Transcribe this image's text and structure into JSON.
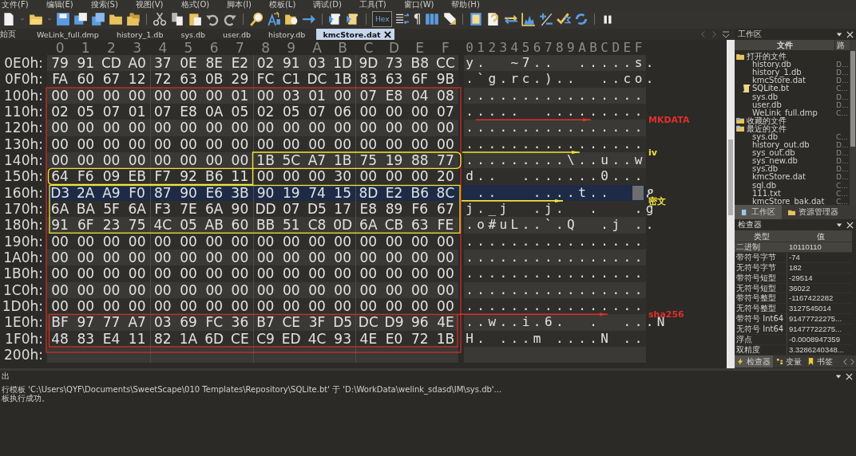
{
  "menu": [
    "文件(F)",
    "编辑(E)",
    "搜索(S)",
    "视图(V)",
    "格式(O)",
    "脚本(I)",
    "模板(L)",
    "调试(D)",
    "工具(T)",
    "窗口(W)",
    "帮助(H)"
  ],
  "toolbar": {
    "hex_toggle": {
      "label": "Hex",
      "on": true
    },
    "pilcrow": "¶"
  },
  "tabs": [
    {
      "label": "始页",
      "selected": false
    },
    {
      "label": "WeLink_full.dmp",
      "selected": false
    },
    {
      "label": "history_1.db",
      "selected": false
    },
    {
      "label": "sys.db",
      "selected": false
    },
    {
      "label": "user.db",
      "selected": false
    },
    {
      "label": "history.db",
      "selected": false
    },
    {
      "label": "kmcStore.dat",
      "selected": true
    }
  ],
  "hex_view": {
    "column_headers": [
      "0",
      "1",
      "2",
      "3",
      "4",
      "5",
      "6",
      "7",
      "8",
      "9",
      "A",
      "B",
      "C",
      "D",
      "E",
      "F"
    ],
    "text_header": "0123456789ABCDEF",
    "rows": [
      {
        "offset": "0E0h:",
        "bytes": [
          "79",
          "91",
          "CD",
          "A0",
          "37",
          "0E",
          "8E",
          "E2",
          "02",
          "91",
          "03",
          "1D",
          "9D",
          "73",
          "B8",
          "CC"
        ],
        "text": "y.  ~7..  .....s.",
        "selected": false
      },
      {
        "offset": "0F0h:",
        "bytes": [
          "FA",
          "60",
          "67",
          "12",
          "72",
          "63",
          "0B",
          "29",
          "FC",
          "C1",
          "DC",
          "1B",
          "83",
          "63",
          "6F",
          "9B"
        ],
        "text": ".`g.rc.)..  ..co.",
        "selected": false
      },
      {
        "offset": "100h:",
        "bytes": [
          "00",
          "00",
          "00",
          "00",
          "00",
          "00",
          "00",
          "01",
          "00",
          "03",
          "01",
          "00",
          "07",
          "E8",
          "04",
          "08"
        ],
        "text": "................",
        "selected": false
      },
      {
        "offset": "110h:",
        "bytes": [
          "02",
          "05",
          "07",
          "01",
          "07",
          "E8",
          "0A",
          "05",
          "02",
          "05",
          "07",
          "06",
          "00",
          "00",
          "00",
          "07"
        ],
        "text": ".....  .........",
        "selected": false
      },
      {
        "offset": "120h:",
        "bytes": [
          "00",
          "00",
          "00",
          "00",
          "00",
          "00",
          "00",
          "00",
          "00",
          "00",
          "00",
          "00",
          "00",
          "00",
          "00",
          "00"
        ],
        "text": "................",
        "selected": false
      },
      {
        "offset": "130h:",
        "bytes": [
          "00",
          "00",
          "00",
          "00",
          "00",
          "00",
          "00",
          "00",
          "00",
          "00",
          "00",
          "00",
          "00",
          "00",
          "00",
          "00"
        ],
        "text": "................",
        "selected": false
      },
      {
        "offset": "140h:",
        "bytes": [
          "00",
          "00",
          "00",
          "00",
          "00",
          "00",
          "00",
          "00",
          "1B",
          "5C",
          "A7",
          "1B",
          "75",
          "19",
          "88",
          "77"
        ],
        "text": ".........\\..u..w",
        "selected": false
      },
      {
        "offset": "150h:",
        "bytes": [
          "64",
          "F6",
          "09",
          "EB",
          "F7",
          "92",
          "B6",
          "11",
          "00",
          "00",
          "00",
          "30",
          "00",
          "00",
          "00",
          "20"
        ],
        "text": "d..  .......0...",
        "selected": false
      },
      {
        "offset": "160h:",
        "bytes": [
          "D3",
          "2A",
          "A9",
          "F0",
          "87",
          "90",
          "E6",
          "3B",
          "90",
          "19",
          "74",
          "15",
          "8D",
          "E2",
          "B6",
          "8C"
        ],
        "text": " ..   ....t..  ",
        "text_tail": "ዖ",
        "selected": true
      },
      {
        "offset": "170h:",
        "bytes": [
          "6A",
          "BA",
          "5F",
          "6A",
          "F3",
          "7E",
          "6A",
          "90",
          "DD",
          "07",
          "D5",
          "17",
          "E8",
          "89",
          "F6",
          "67"
        ],
        "text": "j._j  .j.  .   .g",
        "selected": false
      },
      {
        "offset": "180h:",
        "bytes": [
          "91",
          "6F",
          "23",
          "75",
          "4C",
          "05",
          "AB",
          "60",
          "BB",
          "51",
          "C8",
          "0D",
          "6A",
          "CB",
          "63",
          "FE"
        ],
        "text": ".o#uL..`.Q  .j ..",
        "selected": false
      },
      {
        "offset": "190h:",
        "bytes": [
          "00",
          "00",
          "00",
          "00",
          "00",
          "00",
          "00",
          "00",
          "00",
          "00",
          "00",
          "00",
          "00",
          "00",
          "00",
          "00"
        ],
        "text": "................",
        "selected": false
      },
      {
        "offset": "1A0h:",
        "bytes": [
          "00",
          "00",
          "00",
          "00",
          "00",
          "00",
          "00",
          "00",
          "00",
          "00",
          "00",
          "00",
          "00",
          "00",
          "00",
          "00"
        ],
        "text": "................",
        "selected": false
      },
      {
        "offset": "1B0h:",
        "bytes": [
          "00",
          "00",
          "00",
          "00",
          "00",
          "00",
          "00",
          "00",
          "00",
          "00",
          "00",
          "00",
          "00",
          "00",
          "00",
          "00"
        ],
        "text": "................",
        "selected": false
      },
      {
        "offset": "1C0h:",
        "bytes": [
          "00",
          "00",
          "00",
          "00",
          "00",
          "00",
          "00",
          "00",
          "00",
          "00",
          "00",
          "00",
          "00",
          "00",
          "00",
          "00"
        ],
        "text": "................",
        "selected": false
      },
      {
        "offset": "1D0h:",
        "bytes": [
          "00",
          "00",
          "00",
          "00",
          "00",
          "00",
          "00",
          "00",
          "00",
          "00",
          "00",
          "00",
          "00",
          "00",
          "00",
          "00"
        ],
        "text": "................",
        "selected": false
      },
      {
        "offset": "1E0h:",
        "bytes": [
          "BF",
          "97",
          "77",
          "A7",
          "03",
          "69",
          "FC",
          "36",
          "B7",
          "CE",
          "3F",
          "D5",
          "DC",
          "D9",
          "96",
          "4E"
        ],
        "text": "..w..i.6.  .  ...N",
        "selected": false
      },
      {
        "offset": "1F0h:",
        "bytes": [
          "48",
          "83",
          "E4",
          "11",
          "82",
          "1A",
          "6D",
          "CE",
          "C9",
          "ED",
          "4C",
          "93",
          "4E",
          "E0",
          "72",
          "1B"
        ],
        "text": "H. ...m ....N ..",
        "selected": false
      },
      {
        "offset": "200h:",
        "selected": false
      }
    ]
  },
  "annotations": [
    {
      "label": "MKDATA",
      "color": "#e0302a"
    },
    {
      "label": "iv",
      "color": "#f2e43a"
    },
    {
      "label": "密文",
      "color": "#f2e43a"
    },
    {
      "label": "sha256",
      "color": "#e0302a"
    }
  ],
  "workspace": {
    "title": "工作区",
    "columns": [
      "文件",
      "路"
    ],
    "items": [
      {
        "label": "打开的文件",
        "kind": "open",
        "children": [
          {
            "label": "history.db",
            "path": "D...",
            "kind": "file"
          },
          {
            "label": "history_1.db",
            "path": "D...",
            "kind": "file"
          },
          {
            "label": "kmcStore.dat",
            "path": "D...",
            "kind": "file"
          },
          {
            "label": "SQLite.bt",
            "path": "C...",
            "kind": "template"
          },
          {
            "label": "sys.db",
            "path": "D...",
            "kind": "file"
          },
          {
            "label": "user.db",
            "path": "D...",
            "kind": "file"
          },
          {
            "label": "WeLink_full.dmp",
            "path": "C...",
            "kind": "file"
          }
        ]
      },
      {
        "label": "收藏的文件",
        "kind": "favorites"
      },
      {
        "label": "最近的文件",
        "kind": "recent",
        "children": [
          {
            "label": "sys.db",
            "path": "C...",
            "kind": "file"
          },
          {
            "label": "history_out.db",
            "path": "D...",
            "kind": "file"
          },
          {
            "label": "sys_out.db",
            "path": "D...",
            "kind": "file"
          },
          {
            "label": "sys_new.db",
            "path": "D...",
            "kind": "file"
          },
          {
            "label": "sys.db",
            "path": "D...",
            "kind": "file"
          },
          {
            "label": "kmcStore.dat",
            "path": "D...",
            "kind": "file"
          },
          {
            "label": "sql.db",
            "path": "C...",
            "kind": "file"
          },
          {
            "label": "111.txt",
            "path": "C...",
            "kind": "file"
          },
          {
            "label": "kmcStore_bak.dat",
            "path": "C...",
            "kind": "file"
          }
        ]
      }
    ],
    "tabs": [
      {
        "label": "工作区",
        "selected": true
      },
      {
        "label": "资源管理器",
        "selected": false
      }
    ]
  },
  "inspector": {
    "title": "检查器",
    "columns": [
      "类型",
      "值"
    ],
    "rows": [
      {
        "type": "二进制",
        "value": "10110110",
        "selected": true
      },
      {
        "type": "带符号字节",
        "value": "-74",
        "selected": false
      },
      {
        "type": "无符号字节",
        "value": "182",
        "selected": false
      },
      {
        "type": "带符号短型",
        "value": "-29514",
        "selected": false
      },
      {
        "type": "无符号短型",
        "value": "36022",
        "selected": false
      },
      {
        "type": "带符号整型",
        "value": "-1167422282",
        "selected": false
      },
      {
        "type": "无符号整型",
        "value": "3127545014",
        "selected": false
      },
      {
        "type": "带符号 Int64",
        "value": "91477722275...",
        "selected": false
      },
      {
        "type": "无符号 Int64",
        "value": "91477722275...",
        "selected": false
      },
      {
        "type": "浮点",
        "value": "-0.0008947359",
        "selected": false
      },
      {
        "type": "双精度",
        "value": "3.3286240348...",
        "selected": false
      }
    ],
    "tabs": [
      {
        "label": "检查器",
        "selected": true
      },
      {
        "label": "变量",
        "selected": false
      },
      {
        "label": "书签",
        "selected": false
      }
    ]
  },
  "output": {
    "title": "出",
    "lines": [
      "行模板 'C:\\Users\\QYF\\Documents\\SweetScape\\010 Templates\\Repository\\SQLite.bt' 于 'D:\\WorkData\\welink_sdasd\\IM\\sys.db'...",
      "板执行成功。"
    ]
  }
}
